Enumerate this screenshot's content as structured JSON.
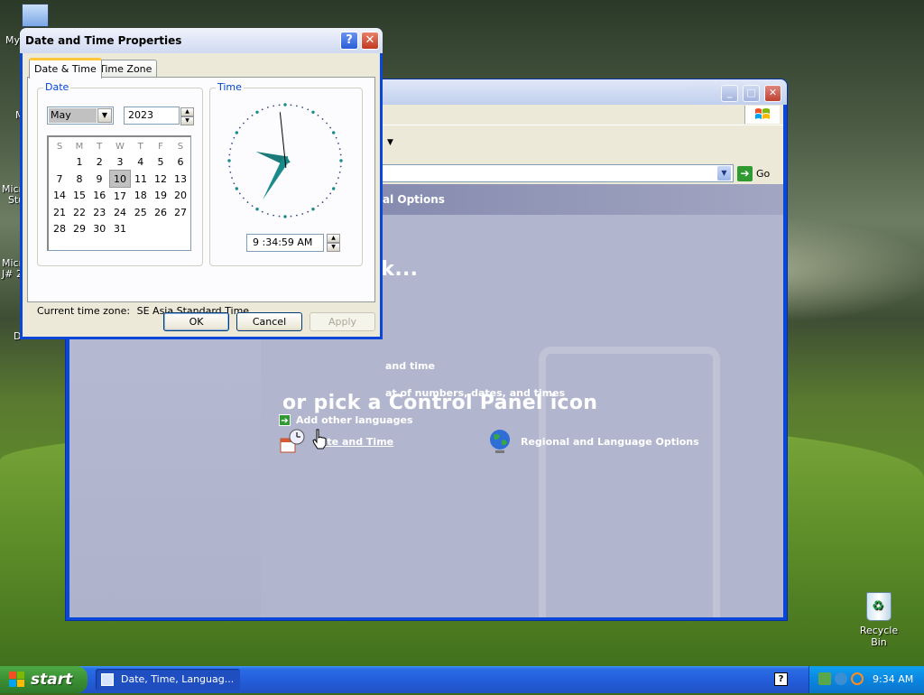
{
  "desktop": {
    "icon_labels": [
      "My",
      "M",
      "Micr",
      "Stu",
      "Micr",
      "J# 2",
      "D"
    ],
    "recycle_bin": "Recycle Bin"
  },
  "control_panel": {
    "go_label": "Go",
    "header_text": "guage, and Regional Options",
    "pick_task": "sk...",
    "tasks": [
      "and time",
      "at of numbers, dates, and times",
      "Add other languages"
    ],
    "pick_icon": "or pick a Control Panel icon",
    "links": [
      "ate and Time",
      "Regional and Language Options"
    ]
  },
  "dialog": {
    "title": "Date and Time Properties",
    "help_glyph": "?",
    "close_glyph": "✕",
    "tabs": [
      "Date & Time",
      "Time Zone"
    ],
    "date_group": "Date",
    "time_group": "Time",
    "month": "May",
    "year": "2023",
    "weekdays": [
      "S",
      "M",
      "T",
      "W",
      "T",
      "F",
      "S"
    ],
    "calendar_rows": [
      [
        "",
        "1",
        "2",
        "3",
        "4",
        "5",
        "6"
      ],
      [
        "7",
        "8",
        "9",
        "10",
        "11",
        "12",
        "13"
      ],
      [
        "14",
        "15",
        "16",
        "17",
        "18",
        "19",
        "20"
      ],
      [
        "21",
        "22",
        "23",
        "24",
        "25",
        "26",
        "27"
      ],
      [
        "28",
        "29",
        "30",
        "31",
        "",
        "",
        ""
      ]
    ],
    "selected_day": "10",
    "time_value": "9 :34:59 AM",
    "clock": {
      "hour": 9,
      "minute": 34,
      "second": 59
    },
    "timezone_label": "Current time zone:",
    "timezone_value": "SE Asia Standard Time",
    "ok": "OK",
    "cancel": "Cancel",
    "apply": "Apply"
  },
  "taskbar": {
    "start": "start",
    "task_button": "Date, Time, Languag...",
    "help_glyph": "?",
    "clock": "9:34 AM"
  },
  "colors": {
    "xp_blue": "#0a46d8",
    "start_green": "#3b8f34",
    "dialog_face": "#ece9d8",
    "link_color": "#ffffff"
  }
}
